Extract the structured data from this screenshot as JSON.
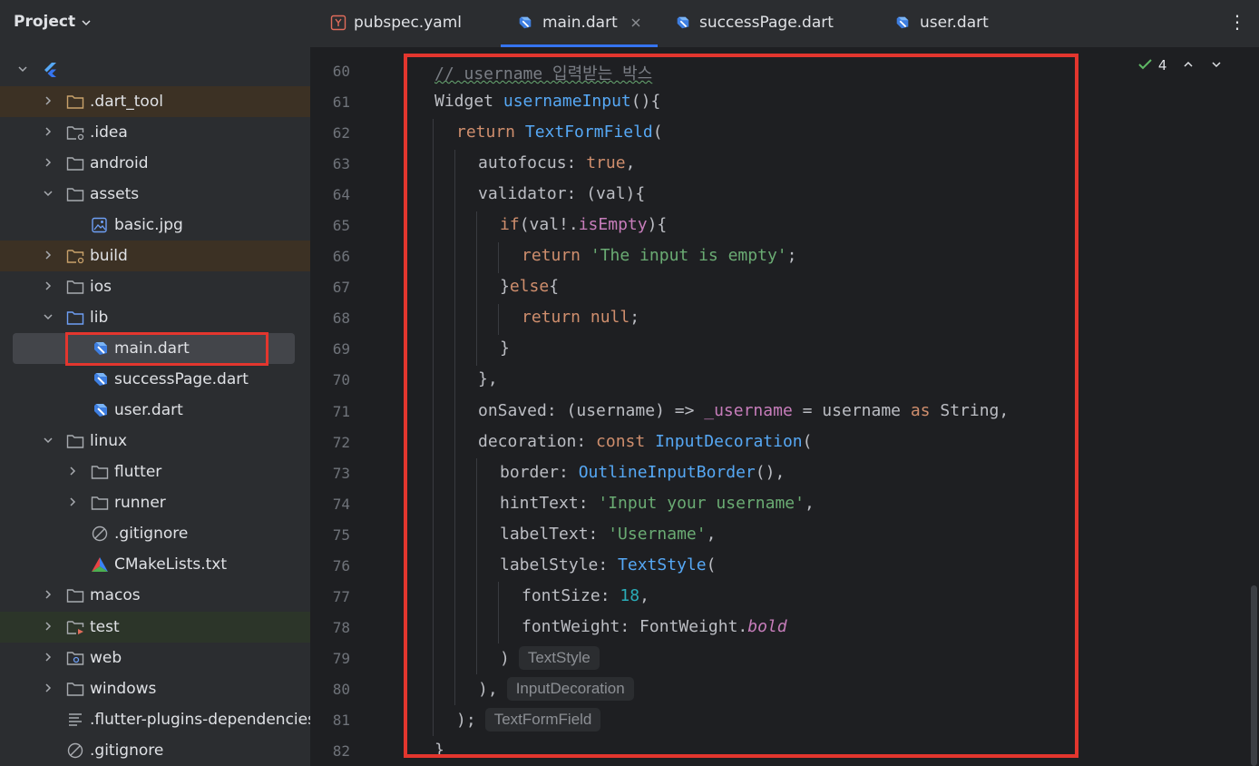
{
  "project_panel": {
    "title": "Project",
    "items": [
      {
        "label": "",
        "icon": "flutter-icon",
        "expanded": true
      },
      {
        "label": ".dart_tool",
        "icon": "folder-icon"
      },
      {
        "label": ".idea",
        "icon": "folder-settings-icon"
      },
      {
        "label": "android",
        "icon": "folder-icon"
      },
      {
        "label": "assets",
        "icon": "folder-icon",
        "expanded": true
      },
      {
        "label": "basic.jpg",
        "icon": "image-file-icon"
      },
      {
        "label": "build",
        "icon": "folder-excluded-icon"
      },
      {
        "label": "ios",
        "icon": "folder-icon"
      },
      {
        "label": "lib",
        "icon": "source-folder-icon",
        "expanded": true
      },
      {
        "label": "main.dart",
        "icon": "dart-file-icon",
        "selected": true
      },
      {
        "label": "successPage.dart",
        "icon": "dart-file-icon"
      },
      {
        "label": "user.dart",
        "icon": "dart-file-icon"
      },
      {
        "label": "linux",
        "icon": "folder-icon",
        "expanded": true
      },
      {
        "label": "flutter",
        "icon": "folder-icon"
      },
      {
        "label": "runner",
        "icon": "folder-icon"
      },
      {
        "label": ".gitignore",
        "icon": "gitignore-icon"
      },
      {
        "label": "CMakeLists.txt",
        "icon": "cmake-icon"
      },
      {
        "label": "macos",
        "icon": "folder-icon"
      },
      {
        "label": "test",
        "icon": "test-folder-icon"
      },
      {
        "label": "web",
        "icon": "web-folder-icon"
      },
      {
        "label": "windows",
        "icon": "folder-icon"
      },
      {
        "label": ".flutter-plugins-dependencies",
        "icon": "text-file-icon"
      },
      {
        "label": ".gitignore",
        "icon": "gitignore-icon"
      }
    ]
  },
  "tabs": [
    {
      "label": "pubspec.yaml",
      "icon": "yaml-file-icon"
    },
    {
      "label": "main.dart",
      "icon": "dart-file-icon",
      "active": true
    },
    {
      "label": "successPage.dart",
      "icon": "dart-file-icon"
    },
    {
      "label": "user.dart",
      "icon": "dart-file-icon"
    }
  ],
  "inspection": {
    "count": "4"
  },
  "code": {
    "line_numbers": [
      "60",
      "61",
      "62",
      "63",
      "64",
      "65",
      "66",
      "67",
      "68",
      "69",
      "70",
      "71",
      "72",
      "73",
      "74",
      "75",
      "76",
      "77",
      "78",
      "79",
      "80",
      "81",
      "82"
    ],
    "comment": "// username 입력받는 박스",
    "l61_kw": "Widget",
    "l61_fn": "usernameInput",
    "l61_rest": "(){",
    "l62_kw": "return",
    "l62_cls": "TextFormField",
    "l62_rest": "(",
    "l63_key": "autofocus: ",
    "l63_val": "true",
    "l63_rest": ",",
    "l64_text": "validator: (val){",
    "l65_kw": "if",
    "l65_a": "(val!.",
    "l65_prop": "isEmpty",
    "l65_b": "){",
    "l66_kw": "return",
    "l66_str": "'The input is empty'",
    "l66_rest": ";",
    "l67_a": "}",
    "l67_kw": "else",
    "l67_b": "{",
    "l68_kw": "return",
    "l68_val": "null",
    "l68_rest": ";",
    "l69_text": "}",
    "l70_text": "},",
    "l71_a": "onSaved: (username) => ",
    "l71_field": "_username",
    "l71_b": " = username ",
    "l71_kw": "as",
    "l71_c": " String,",
    "l72_key": "decoration: ",
    "l72_kw": "const",
    "l72_cls": "InputDecoration",
    "l72_rest": "(",
    "l73_key": "border: ",
    "l73_cls": "OutlineInputBorder",
    "l73_rest": "(),",
    "l74_key": "hintText: ",
    "l74_str": "'Input your username'",
    "l74_rest": ",",
    "l75_key": "labelText: ",
    "l75_str": "'Username'",
    "l75_rest": ",",
    "l76_key": "labelStyle: ",
    "l76_cls": "TextStyle",
    "l76_rest": "(",
    "l77_key": "fontSize: ",
    "l77_num": "18",
    "l77_rest": ",",
    "l78_key": "fontWeight: FontWeight.",
    "l78_val": "bold",
    "l79_text": ")",
    "l79_hint": "TextStyle",
    "l80_text": "),",
    "l80_hint": "InputDecoration",
    "l81_text": ");",
    "l81_hint": "TextFormField",
    "l82_text": "}"
  }
}
